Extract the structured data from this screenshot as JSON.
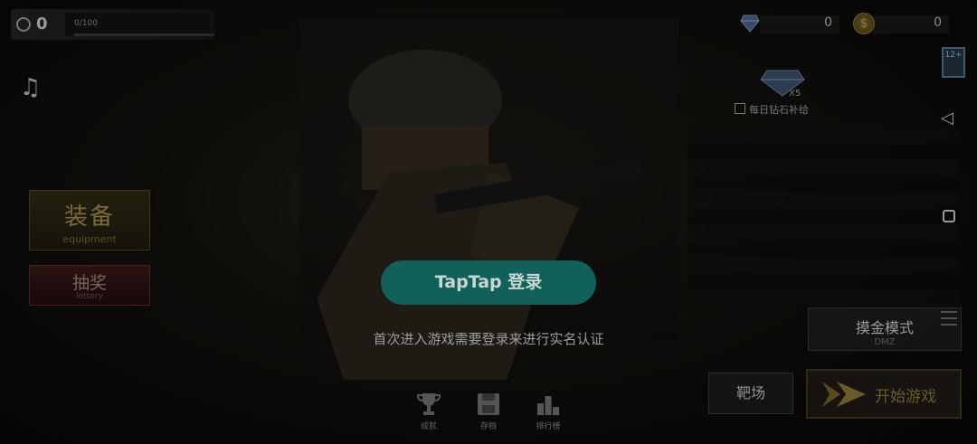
{
  "hud": {
    "level": "0",
    "exp_text": "0/100",
    "exp_fraction": 0.0
  },
  "currency": {
    "diamonds": "0",
    "coins": "0"
  },
  "age_rating": "12+",
  "daily_supply": {
    "multiplier": "X5",
    "label": "每日钻石补给"
  },
  "left_menu": {
    "equipment": {
      "title": "装备",
      "subtitle": "equipment"
    },
    "lottery": {
      "title": "抽奖",
      "subtitle": "lottery"
    }
  },
  "login": {
    "button_label": "TapTap 登录",
    "hint": "首次进入游戏需要登录来进行实名认证"
  },
  "bottom_nav": [
    {
      "label": "成就",
      "icon": "trophy-icon"
    },
    {
      "label": "存档",
      "icon": "save-icon"
    },
    {
      "label": "排行榜",
      "icon": "leaderboard-icon"
    }
  ],
  "modes": {
    "dmz": {
      "title": "摸金模式",
      "subtitle": "DMZ"
    },
    "range": "靶场",
    "start": "开始游戏"
  },
  "colors": {
    "login_button": "#11615a",
    "start_accent": "#6a5a2a"
  }
}
